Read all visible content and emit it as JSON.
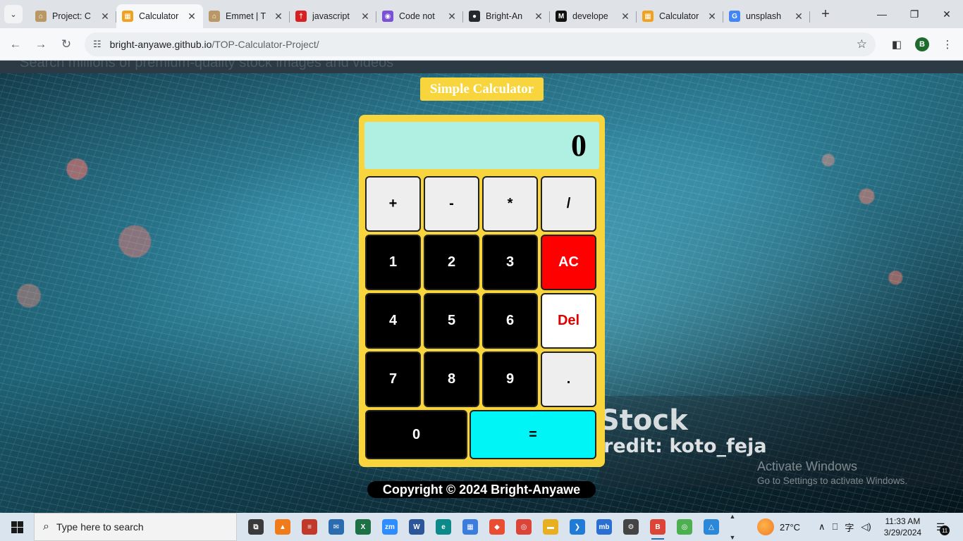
{
  "browser": {
    "tabs": [
      {
        "title": "Project: C",
        "favicon_color": "#b99866",
        "favicon_glyph": "⌂",
        "active": false
      },
      {
        "title": "Calculator",
        "favicon_color": "#f0a21e",
        "favicon_glyph": "▦",
        "active": true
      },
      {
        "title": "Emmet | T",
        "favicon_color": "#b99866",
        "favicon_glyph": "⌂",
        "active": false
      },
      {
        "title": "javascript",
        "favicon_color": "#d92020",
        "favicon_glyph": "†",
        "active": false
      },
      {
        "title": "Code not",
        "favicon_color": "#7b4fd8",
        "favicon_glyph": "◉",
        "active": false
      },
      {
        "title": "Bright-An",
        "favicon_color": "#24292e",
        "favicon_glyph": "●",
        "active": false
      },
      {
        "title": "develope",
        "favicon_color": "#111111",
        "favicon_glyph": "M",
        "active": false
      },
      {
        "title": "Calculator",
        "favicon_color": "#f0a21e",
        "favicon_glyph": "▦",
        "active": false
      },
      {
        "title": "unsplash",
        "favicon_color": "#4285f4",
        "favicon_glyph": "G",
        "active": false
      }
    ],
    "tab_close_glyph": "✕",
    "new_tab_glyph": "+",
    "tab_search_glyph": "⌄",
    "window_controls": {
      "minimize": "—",
      "restore": "❐",
      "close": "✕"
    },
    "nav": {
      "back": "←",
      "forward": "→",
      "reload": "↻"
    },
    "omnibox": {
      "site_info_glyph": "☷",
      "url_host": "bright-anyawe.github.io",
      "url_path": "/TOP-Calculator-Project/",
      "bookmark_glyph": "☆"
    },
    "toolbar_right": {
      "sidepanel_glyph": "◧",
      "profile_initial": "B",
      "menu_glyph": "⋮"
    }
  },
  "page": {
    "background_banner_text": "Search millions of premium-quality stock images and videos",
    "watermark": {
      "brand": "Stock",
      "credit": "redit: koto_feja"
    },
    "calculator": {
      "title": "Simple Calculator",
      "display_value": "0",
      "keys": [
        {
          "label": "+",
          "kind": "op"
        },
        {
          "label": "-",
          "kind": "op"
        },
        {
          "label": "*",
          "kind": "op"
        },
        {
          "label": "/",
          "kind": "op"
        },
        {
          "label": "1",
          "kind": "num"
        },
        {
          "label": "2",
          "kind": "num"
        },
        {
          "label": "3",
          "kind": "num"
        },
        {
          "label": "AC",
          "kind": "ac"
        },
        {
          "label": "4",
          "kind": "num"
        },
        {
          "label": "5",
          "kind": "num"
        },
        {
          "label": "6",
          "kind": "num"
        },
        {
          "label": "Del",
          "kind": "del"
        },
        {
          "label": "7",
          "kind": "num"
        },
        {
          "label": "8",
          "kind": "num"
        },
        {
          "label": "9",
          "kind": "num"
        },
        {
          "label": ".",
          "kind": "dot"
        },
        {
          "label": "0",
          "kind": "num"
        },
        {
          "label": "=",
          "kind": "eq"
        }
      ],
      "colors": {
        "frame": "#f8d53c",
        "display": "#aff0e3",
        "ac": "#ff0000",
        "del_text": "#e00000",
        "equals": "#00f6f6"
      }
    },
    "footer": {
      "copyright": "Copyright © 2024 Bright-Anyawe"
    },
    "activation": {
      "heading": "Activate Windows",
      "subtext": "Go to Settings to activate Windows."
    }
  },
  "taskbar": {
    "search_placeholder": "Type here to search",
    "search_glyph": "⌕",
    "apps": [
      {
        "name": "task-view",
        "glyph": "⧉",
        "color": "#3a3a3a"
      },
      {
        "name": "vlc",
        "glyph": "▲",
        "color": "#f07b1a"
      },
      {
        "name": "notepad",
        "glyph": "≡",
        "color": "#c0392b"
      },
      {
        "name": "mail",
        "glyph": "✉",
        "color": "#2b6cb0"
      },
      {
        "name": "excel",
        "glyph": "X",
        "color": "#1e7145"
      },
      {
        "name": "zoom",
        "glyph": "zm",
        "color": "#2d8cff"
      },
      {
        "name": "word",
        "glyph": "W",
        "color": "#2b579a"
      },
      {
        "name": "edge",
        "glyph": "e",
        "color": "#0c8a8a"
      },
      {
        "name": "store",
        "glyph": "▦",
        "color": "#3b7ddd"
      },
      {
        "name": "git",
        "glyph": "◆",
        "color": "#e84e31"
      },
      {
        "name": "chrome",
        "glyph": "◎",
        "color": "#db4437"
      },
      {
        "name": "file-explorer",
        "glyph": "▬",
        "color": "#e8b020"
      },
      {
        "name": "vscode",
        "glyph": "❯",
        "color": "#1f7bd6"
      },
      {
        "name": "mb",
        "glyph": "mb",
        "color": "#2a6fd1"
      },
      {
        "name": "settings",
        "glyph": "⚙",
        "color": "#444444"
      },
      {
        "name": "chrome-profile-b",
        "glyph": "B",
        "color": "#db4437",
        "open": true
      },
      {
        "name": "chrome-profile-2",
        "glyph": "◎",
        "color": "#4caf50"
      },
      {
        "name": "photos",
        "glyph": "△",
        "color": "#2b88d8"
      }
    ],
    "weather": {
      "temp": "27°C"
    },
    "tray_glyphs": {
      "chevron": "∧",
      "network": "⎕",
      "lang": "字",
      "volume": "◁)"
    },
    "clock": {
      "time": "11:33 AM",
      "date": "3/29/2024"
    },
    "notification": {
      "glyph": "☰",
      "count": "11"
    }
  }
}
